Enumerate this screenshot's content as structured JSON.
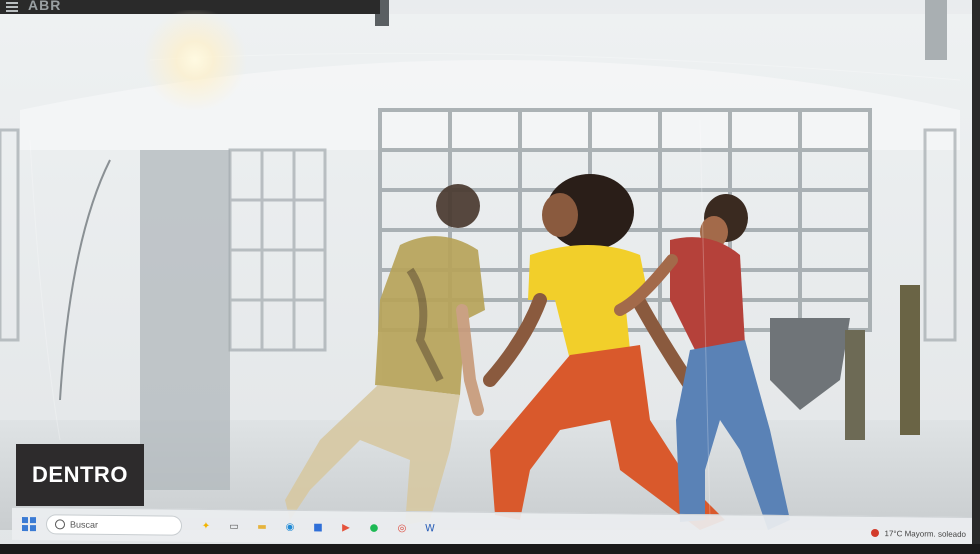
{
  "browser": {
    "top_title": "ABR"
  },
  "hero": {
    "badge_label": "DENTRO"
  },
  "taskbar": {
    "search_placeholder": "Buscar",
    "apps": [
      {
        "name": "widgets-icon",
        "glyph": "✦",
        "color": "#f2b400"
      },
      {
        "name": "task-view-icon",
        "glyph": "▭",
        "color": "#555555"
      },
      {
        "name": "file-explorer-icon",
        "glyph": "▬",
        "color": "#e6b33c"
      },
      {
        "name": "edge-icon",
        "glyph": "◉",
        "color": "#1f8ad6"
      },
      {
        "name": "store-icon",
        "glyph": "■",
        "color": "#2f6fd8"
      },
      {
        "name": "video-app-icon",
        "glyph": "▶",
        "color": "#e5533c"
      },
      {
        "name": "spotify-icon",
        "glyph": "●",
        "color": "#1db954"
      },
      {
        "name": "chrome-icon",
        "glyph": "◎",
        "color": "#db4437"
      },
      {
        "name": "word-icon",
        "glyph": "W",
        "color": "#2b5fb8"
      }
    ],
    "tray_text": "17°C Mayorm. soleado"
  }
}
